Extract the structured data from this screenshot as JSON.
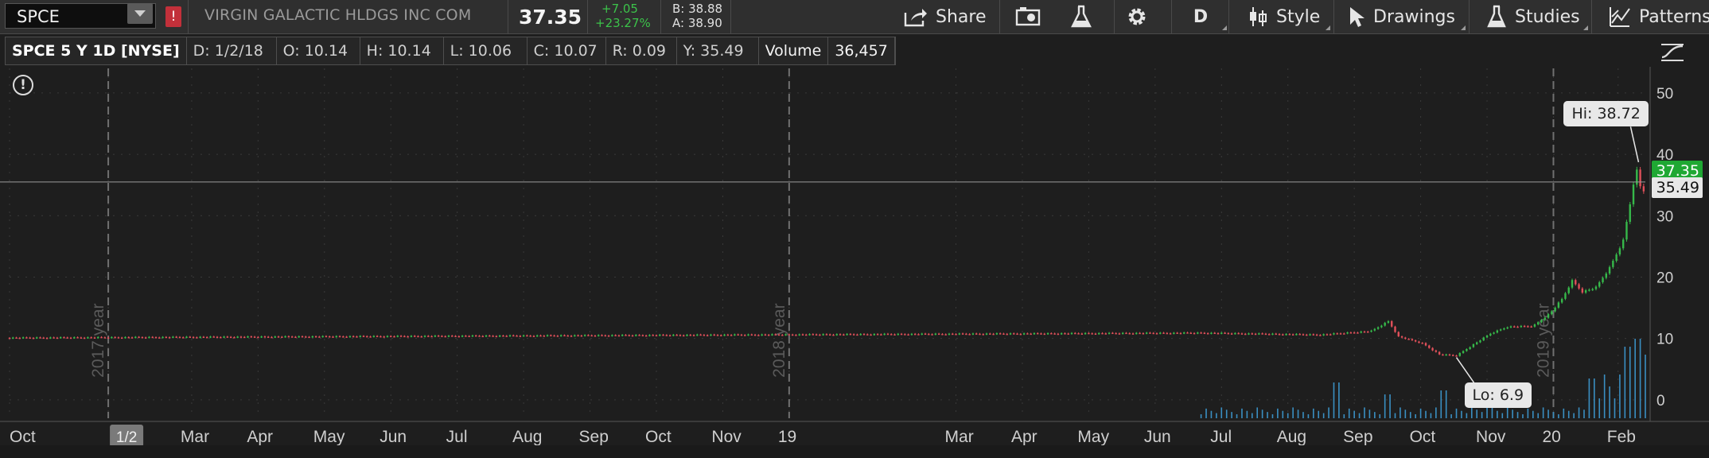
{
  "header": {
    "symbol": "SPCE",
    "alert_badge": "!",
    "company": "VIRGIN GALACTIC HLDGS INC COM",
    "last": "37.35",
    "change_abs": "+7.05",
    "change_pct": "+23.27%",
    "bid": "B: 38.88",
    "ask": "A: 38.90"
  },
  "toolbar": {
    "share": "Share",
    "period": "D",
    "style": "Style",
    "drawings": "Drawings",
    "studies": "Studies",
    "patterns": "Patterns"
  },
  "info": {
    "symbol_period": "SPCE 5 Y 1D [NYSE]",
    "date": "D: 1/2/18",
    "open": "O: 10.14",
    "high": "H: 10.14",
    "low": "L: 10.06",
    "close": "C: 10.07",
    "range": "R: 0.09",
    "y": "Y: 35.49",
    "volume_label": "Volume",
    "volume_value": "36,457"
  },
  "colors": {
    "up": "#36b94a",
    "down": "#e0505a",
    "volume": "#3a8fc2",
    "last_tag": "#1fa833",
    "cursor_tag": "#e8e8e8"
  },
  "chart_data": {
    "type": "line",
    "ylim": [
      -3,
      54
    ],
    "yticks": [
      "0",
      "10",
      "20",
      "30",
      "40",
      "50"
    ],
    "ytick_values": [
      0,
      10,
      20,
      30,
      40,
      50
    ],
    "month_labels": [
      "Oct",
      "1/2",
      "Mar",
      "Apr",
      "May",
      "Jun",
      "Jul",
      "Aug",
      "Sep",
      "Oct",
      "Nov",
      "19",
      "Mar",
      "Apr",
      "May",
      "Jun",
      "Jul",
      "Aug",
      "Sep",
      "Oct",
      "Nov",
      "20",
      "Feb"
    ],
    "month_index": [
      0,
      58,
      107,
      146,
      185,
      224,
      263,
      302,
      341,
      380,
      419,
      458,
      556,
      595,
      634,
      673,
      712,
      751,
      790,
      829,
      868,
      907,
      945
    ],
    "highlighted_label_index": 1,
    "year_markers": [
      {
        "label": "2017 year",
        "index": 58
      },
      {
        "label": "2018 year",
        "index": 458
      },
      {
        "label": "2019 year",
        "index": 907
      }
    ],
    "total_bars": 962,
    "flat_price": 10.1,
    "recent": [
      {
        "index": 700,
        "close": 10.9
      },
      {
        "index": 770,
        "close": 10.6
      },
      {
        "index": 800,
        "close": 11.2
      },
      {
        "index": 810,
        "close": 12.8
      },
      {
        "index": 816,
        "close": 10.3
      },
      {
        "index": 830,
        "close": 9.2
      },
      {
        "index": 840,
        "close": 7.4
      },
      {
        "index": 850,
        "close": 7.2
      },
      {
        "index": 856,
        "close": 8.3
      },
      {
        "index": 870,
        "close": 10.8
      },
      {
        "index": 880,
        "close": 11.9
      },
      {
        "index": 895,
        "close": 12.0
      },
      {
        "index": 905,
        "close": 14.1
      },
      {
        "index": 912,
        "close": 16.4
      },
      {
        "index": 918,
        "close": 19.4
      },
      {
        "index": 924,
        "close": 17.6
      },
      {
        "index": 932,
        "close": 18.3
      },
      {
        "index": 940,
        "close": 21.5
      },
      {
        "index": 948,
        "close": 26.0
      },
      {
        "index": 953,
        "close": 33.5
      },
      {
        "index": 957,
        "close": 38.7
      },
      {
        "index": 959,
        "close": 31.0
      },
      {
        "index": 961,
        "close": 37.35
      }
    ],
    "volume_spikes": [
      {
        "index": 780,
        "value": 0.45
      },
      {
        "index": 810,
        "value": 0.3
      },
      {
        "index": 842,
        "value": 0.35
      },
      {
        "index": 870,
        "value": 0.4
      },
      {
        "index": 930,
        "value": 0.5
      },
      {
        "index": 950,
        "value": 0.9
      },
      {
        "index": 957,
        "value": 1.0
      },
      {
        "index": 961,
        "value": 0.8
      }
    ],
    "high_label": "Hi: 38.72",
    "low_label": "Lo: 6.9",
    "last_price_label": "37.35",
    "cursor_price_label": "35.49",
    "cursor_price": 35.49
  }
}
